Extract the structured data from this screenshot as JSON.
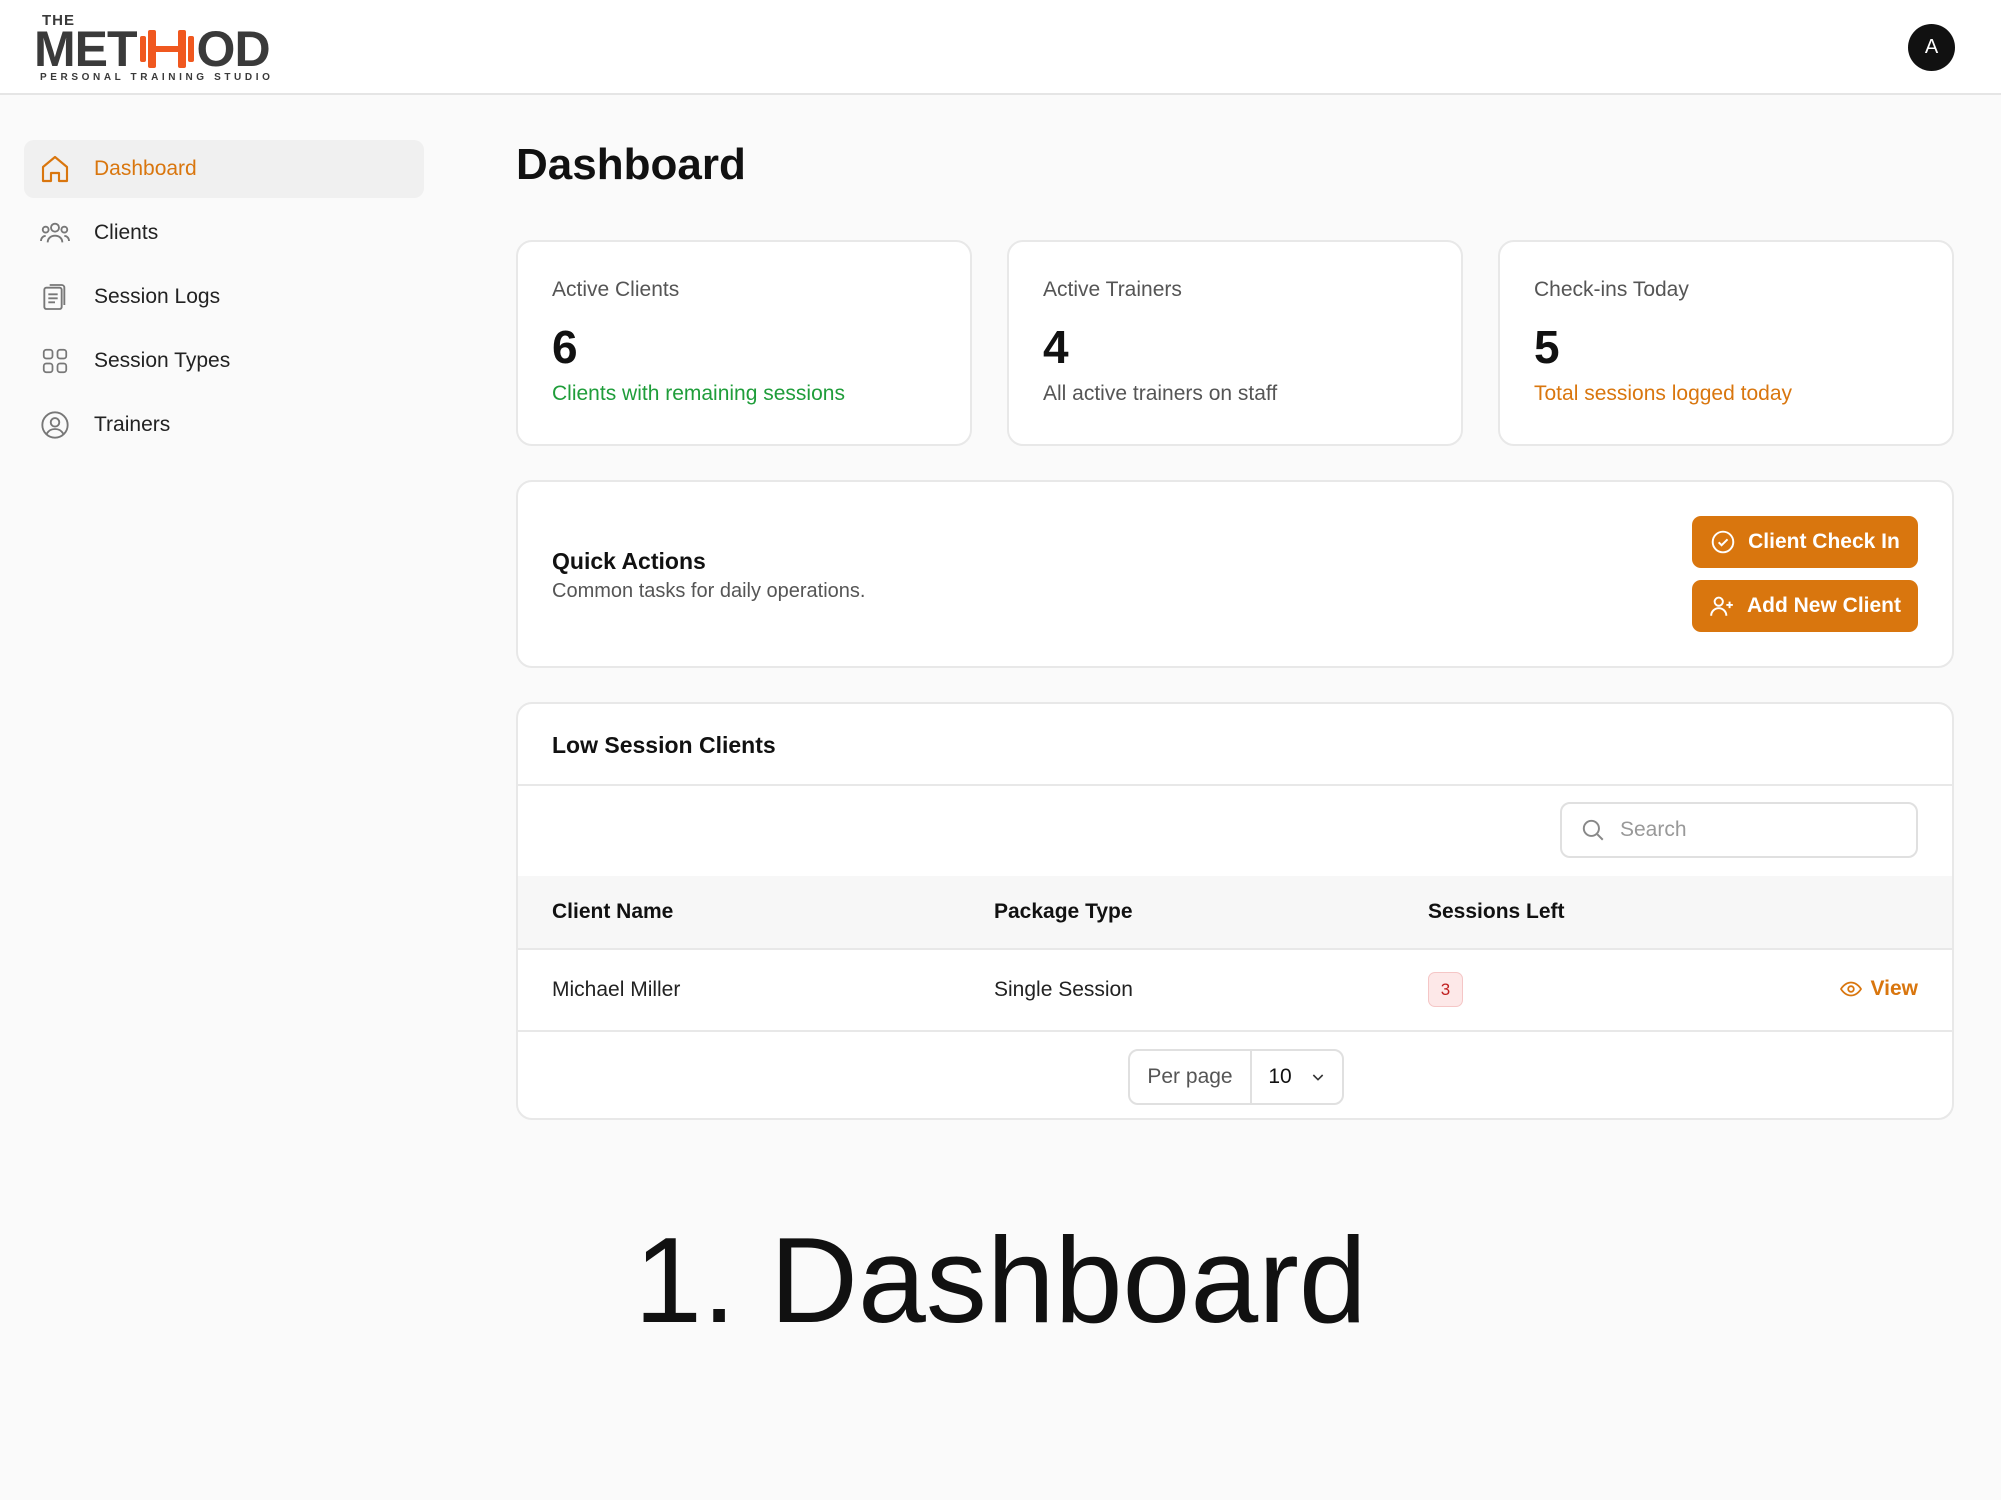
{
  "brand": {
    "logo_the": "THE",
    "logo_left": "MET",
    "logo_right": "OD",
    "logo_sub": "PERSONAL TRAINING STUDIO",
    "accent": "#d9760e",
    "logo_mark_color": "#f0581f"
  },
  "header": {
    "avatar_initial": "A"
  },
  "sidebar": {
    "items": [
      {
        "label": "Dashboard",
        "icon": "home-icon",
        "active": true
      },
      {
        "label": "Clients",
        "icon": "users-icon"
      },
      {
        "label": "Session Logs",
        "icon": "clipboard-icon"
      },
      {
        "label": "Session Types",
        "icon": "grid-icon"
      },
      {
        "label": "Trainers",
        "icon": "user-circle-icon"
      }
    ]
  },
  "page": {
    "title": "Dashboard"
  },
  "stats": [
    {
      "label": "Active Clients",
      "value": "6",
      "desc": "Clients with remaining sessions",
      "desc_color": "#1f9d3a"
    },
    {
      "label": "Active Trainers",
      "value": "4",
      "desc": "All active trainers on staff",
      "desc_color": "#555555"
    },
    {
      "label": "Check-ins Today",
      "value": "5",
      "desc": "Total sessions logged today",
      "desc_color": "#d9760e"
    }
  ],
  "quick_actions": {
    "title": "Quick Actions",
    "subtitle": "Common tasks for daily operations.",
    "check_in_label": "Client Check In",
    "add_client_label": "Add New Client"
  },
  "low_session": {
    "title": "Low Session Clients",
    "search_placeholder": "Search",
    "columns": [
      "Client Name",
      "Package Type",
      "Sessions Left"
    ],
    "rows": [
      {
        "name": "Michael Miller",
        "package": "Single Session",
        "sessions_left": "3",
        "action": "View"
      }
    ],
    "per_page_label": "Per page",
    "per_page_value": "10"
  },
  "caption": "1. Dashboard"
}
